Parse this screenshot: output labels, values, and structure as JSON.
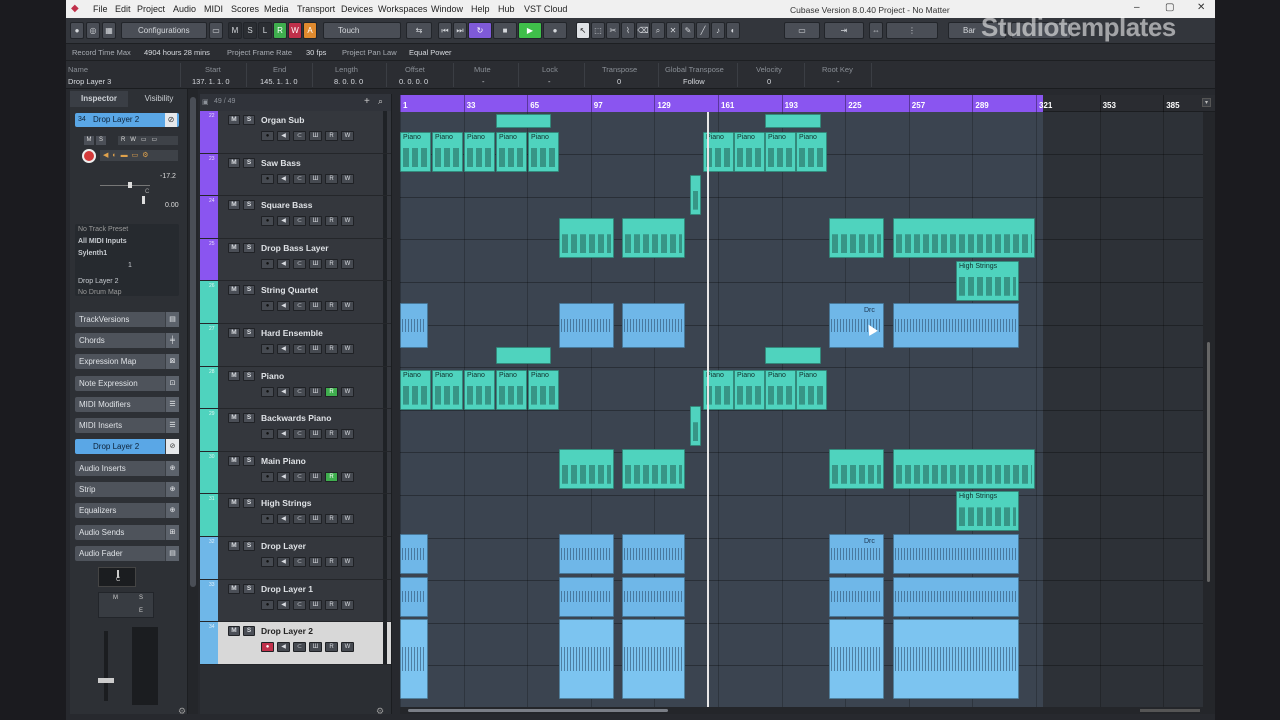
{
  "menu": [
    "File",
    "Edit",
    "Project",
    "Audio",
    "MIDI",
    "Scores",
    "Media",
    "Transport",
    "Devices",
    "Workspaces",
    "Window",
    "Help",
    "Hub",
    "VST Cloud"
  ],
  "window_title": "Cubase Version 8.0.40 Project - No Matter",
  "window_buttons": [
    "–",
    "▢",
    "✕"
  ],
  "watermark": "Studiotemplates",
  "toolbar": {
    "configurations": "Configurations",
    "automation_mode": "Touch",
    "msr": [
      "M",
      "S",
      "L",
      "R",
      "W",
      "A"
    ],
    "grid": "Bar"
  },
  "status": [
    {
      "label": "Record Time Max",
      "value": "4904 hours 28 mins"
    },
    {
      "label": "Project Frame Rate",
      "value": "30 fps"
    },
    {
      "label": "Project Pan Law",
      "value": "Equal Power"
    }
  ],
  "info": {
    "name_label": "Name",
    "name": "Drop Layer 3",
    "start_label": "Start",
    "start": "137. 1. 1. 0",
    "end_label": "End",
    "end": "145. 1. 1. 0",
    "length_label": "Length",
    "length": "8. 0. 0. 0",
    "offset_label": "Offset",
    "offset": "0. 0. 0. 0",
    "mute_label": "Mute",
    "mute": "-",
    "lock_label": "Lock",
    "lock": "-",
    "transpose_label": "Transpose",
    "transpose": "0",
    "gtranspose_label": "Global Transpose",
    "gtranspose": "Follow",
    "velocity_label": "Velocity",
    "velocity": "0",
    "rootkey_label": "Root Key",
    "rootkey": "-"
  },
  "inspector": {
    "tabs": [
      "Inspector",
      "Visibility"
    ],
    "track_num": "34",
    "track_name": "Drop Layer 2",
    "volume": "-17.2",
    "pan": "0.00",
    "pan_c": "C",
    "rows": [
      "No Track Preset",
      "All MIDI Inputs",
      "Sylenth1",
      "1",
      "Drop Layer 2",
      "No Drum Map"
    ],
    "sections": [
      "TrackVersions",
      "Chords",
      "Expression Map",
      "Note Expression",
      "MIDI Modifiers",
      "MIDI Inserts",
      "Drop Layer 2",
      "Audio Inserts",
      "Strip",
      "Equalizers",
      "Audio Sends",
      "Audio Fader"
    ],
    "fader_c": "C",
    "fader_ms": [
      "M",
      "S"
    ],
    "fader_e": "E"
  },
  "tracklist": {
    "counter": "49 / 49"
  },
  "tracks": [
    {
      "num": "22",
      "name": "Organ Sub",
      "color": "#8a55f0",
      "r_on": false
    },
    {
      "num": "23",
      "name": "Saw Bass",
      "color": "#8a55f0",
      "r_on": false
    },
    {
      "num": "24",
      "name": "Square Bass",
      "color": "#8a55f0",
      "r_on": false
    },
    {
      "num": "25",
      "name": "Drop Bass Layer",
      "color": "#8a55f0",
      "r_on": false
    },
    {
      "num": "26",
      "name": "String Quartet",
      "color": "#4fd3be",
      "r_on": false
    },
    {
      "num": "27",
      "name": "Hard Ensemble",
      "color": "#4fd3be",
      "r_on": false
    },
    {
      "num": "28",
      "name": "Piano",
      "color": "#4fd3be",
      "r_on": true
    },
    {
      "num": "29",
      "name": "Backwards Piano",
      "color": "#4fd3be",
      "r_on": false
    },
    {
      "num": "30",
      "name": "Main Piano",
      "color": "#4fd3be",
      "r_on": true
    },
    {
      "num": "31",
      "name": "High Strings",
      "color": "#4fd3be",
      "r_on": false
    },
    {
      "num": "32",
      "name": "Drop Layer",
      "color": "#6fb7e8",
      "r_on": false
    },
    {
      "num": "33",
      "name": "Drop Layer 1",
      "color": "#6fb7e8",
      "r_on": false
    },
    {
      "num": "34",
      "name": "Drop Layer 2",
      "color": "#6fb7e8",
      "r_on": false,
      "selected": true
    }
  ],
  "ruler": [
    "1",
    "33",
    "65",
    "97",
    "129",
    "161",
    "193",
    "225",
    "257",
    "289",
    "321",
    "353",
    "385"
  ],
  "event_labels": {
    "piano": "Piano",
    "high_strings": "High Strings",
    "drop": "Drc"
  }
}
